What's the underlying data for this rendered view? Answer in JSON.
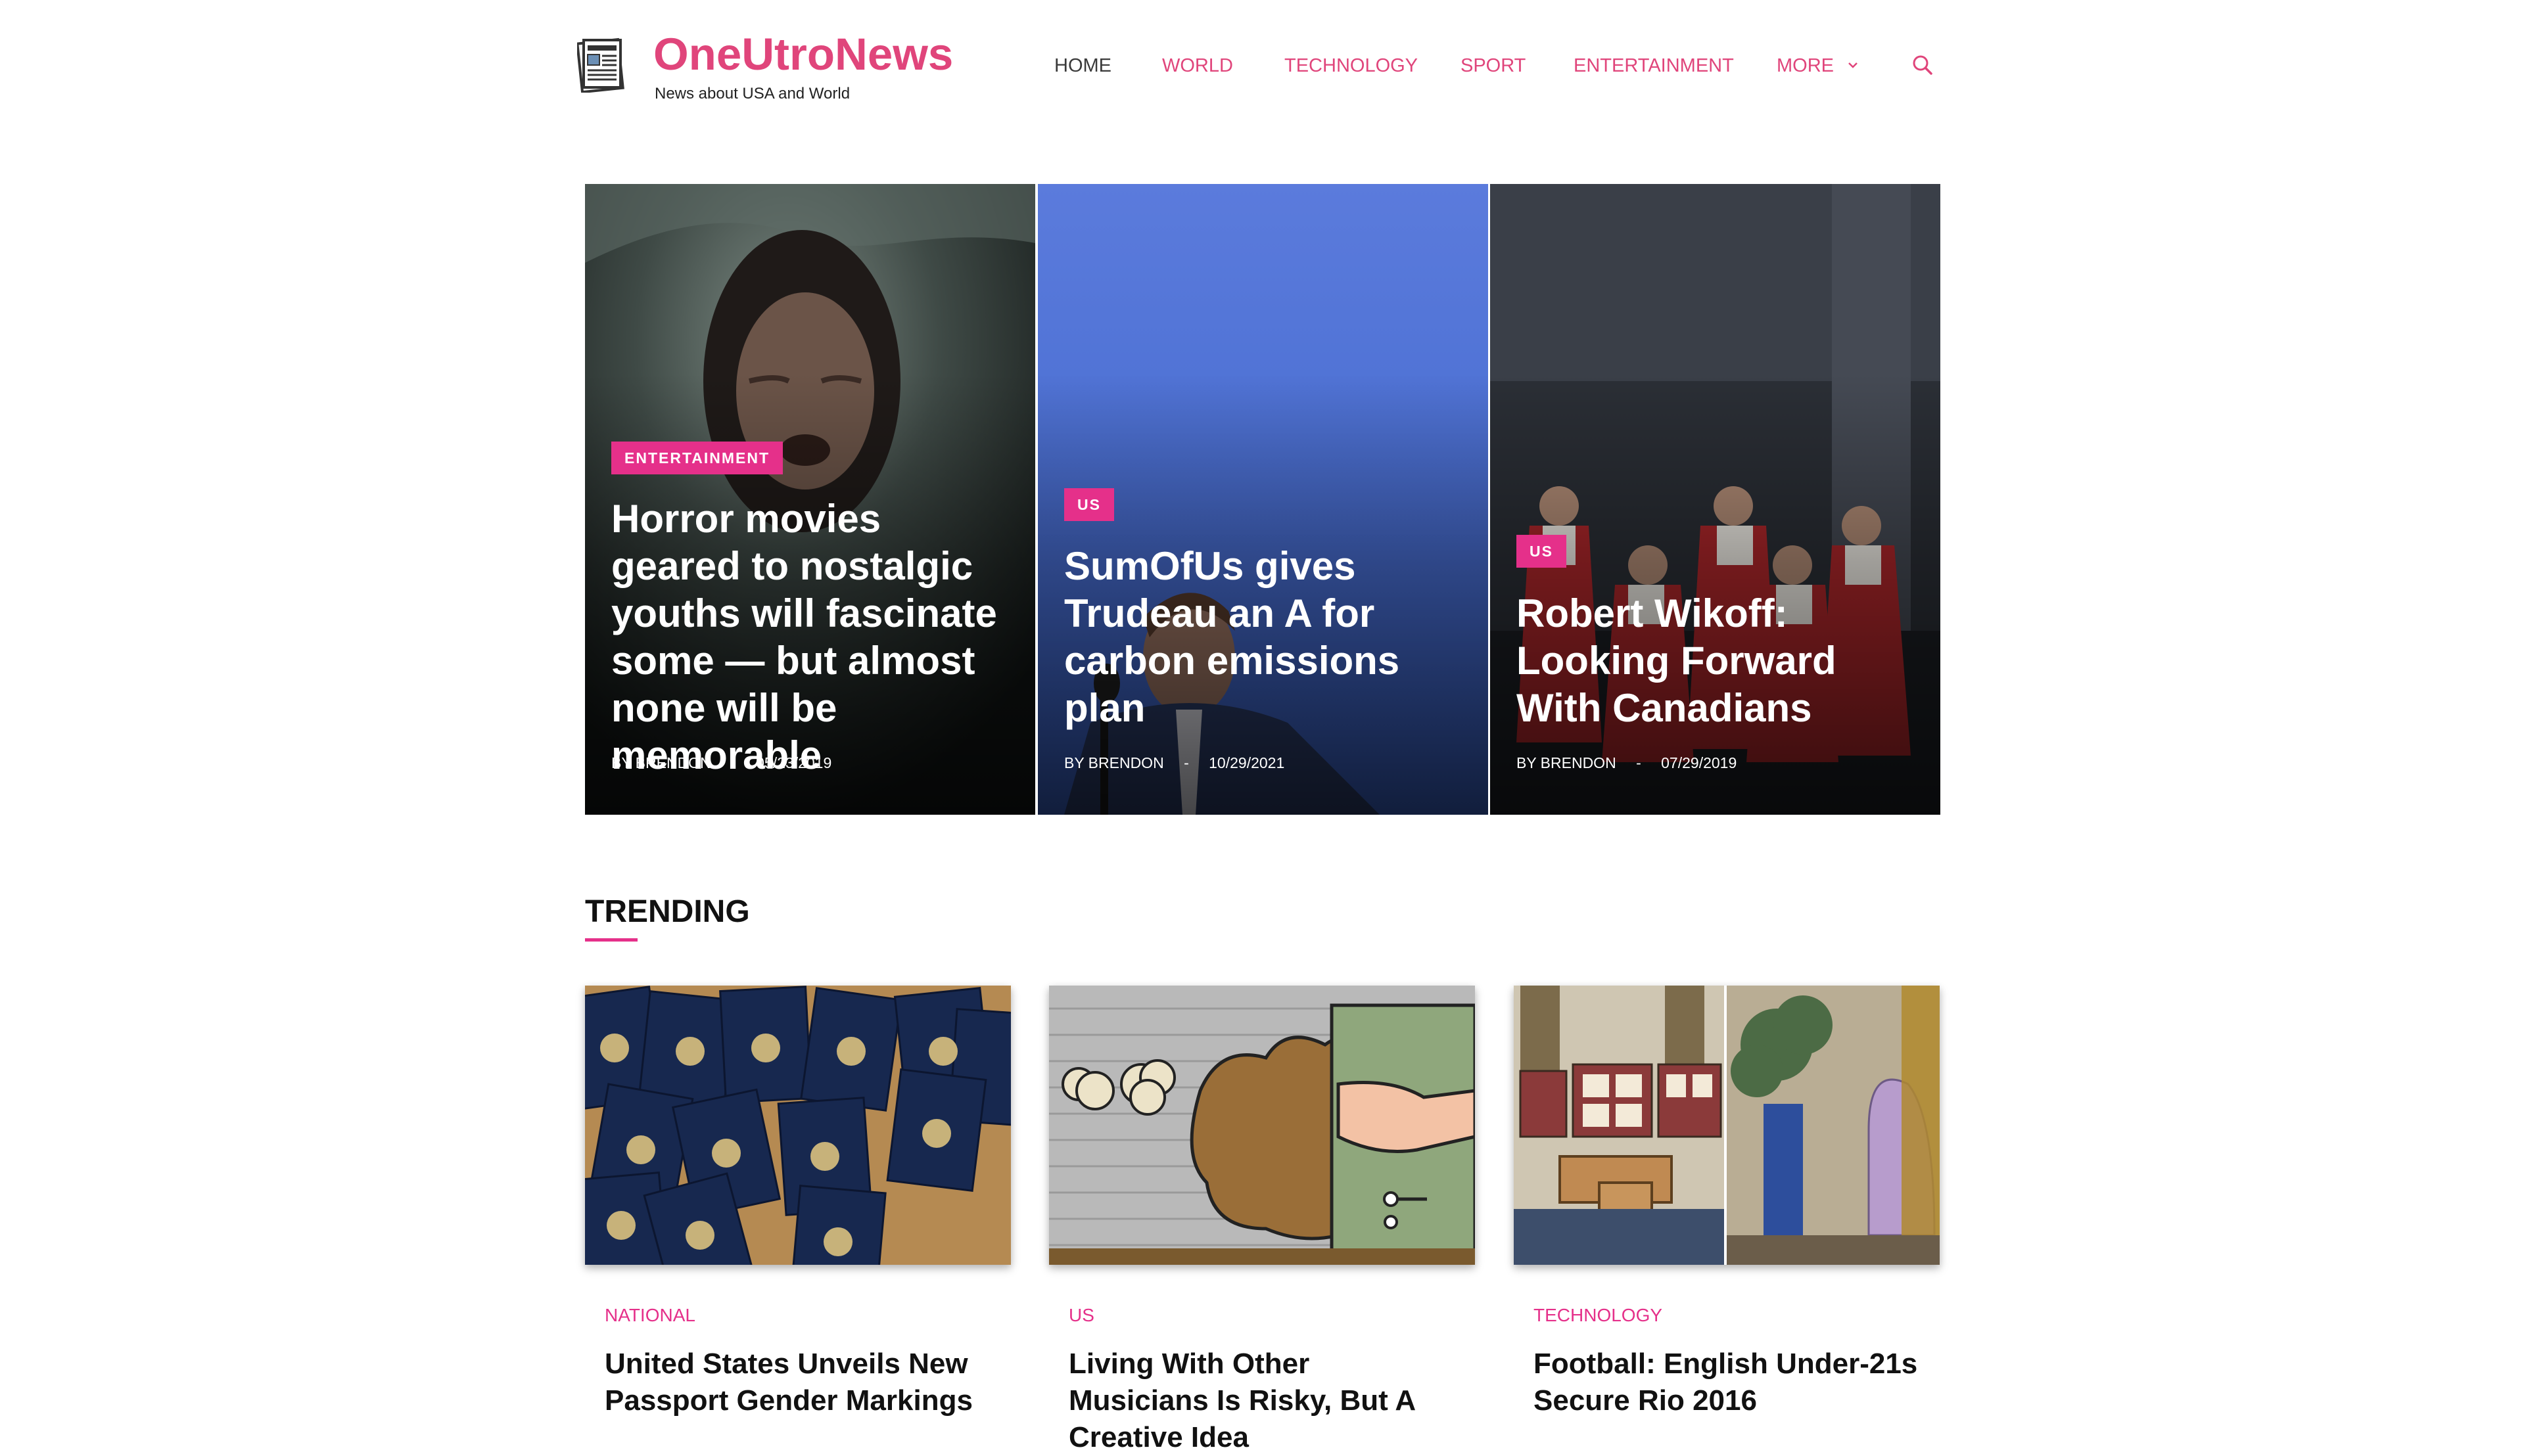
{
  "site": {
    "title": "OneUtroNews",
    "tagline": "News about USA and World",
    "logo_icon": "newspaper-icon",
    "accent_color": "#e0457b",
    "badge_color": "#e5308a"
  },
  "nav": {
    "items": [
      {
        "label": "HOME",
        "active": true
      },
      {
        "label": "WORLD",
        "active": false
      },
      {
        "label": "TECHNOLOGY",
        "active": false
      },
      {
        "label": "SPORT",
        "active": false
      },
      {
        "label": "ENTERTAINMENT",
        "active": false
      },
      {
        "label": "MORE",
        "active": false,
        "icon": "chevron-down-icon"
      }
    ],
    "search_icon": "search-icon"
  },
  "hero": [
    {
      "category": "ENTERTAINMENT",
      "title": "Horror movies geared to nostalgic youths will fascinate some — but almost none will be memorable",
      "author_prefix": "BY",
      "author": "BRENDON",
      "separator": "-",
      "date": "05/23/2019"
    },
    {
      "category": "US",
      "title": "SumOfUs gives Trudeau an A for carbon emissions plan",
      "author_prefix": "BY",
      "author": "BRENDON",
      "separator": "-",
      "date": "10/29/2021"
    },
    {
      "category": "US",
      "title": "Robert Wikoff: Looking Forward With Canadians",
      "author_prefix": "BY",
      "author": "BRENDON",
      "separator": "-",
      "date": "07/29/2019"
    }
  ],
  "trending": {
    "heading": "TRENDING",
    "cards": [
      {
        "category": "NATIONAL",
        "title": "United States Unveils New Passport Gender Markings"
      },
      {
        "category": "US",
        "title": "Living With Other Musicians Is Risky, But A Creative Idea"
      },
      {
        "category": "TECHNOLOGY",
        "title": "Football: English Under-21s Secure Rio 2016"
      }
    ]
  }
}
